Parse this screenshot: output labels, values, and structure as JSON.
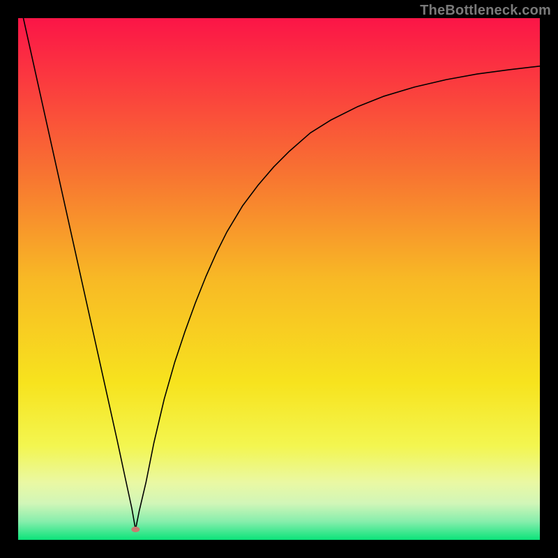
{
  "watermark": "TheBottleneck.com",
  "chart_data": {
    "type": "line",
    "title": "",
    "xlabel": "",
    "ylabel": "",
    "xlim": [
      0,
      100
    ],
    "ylim": [
      0,
      100
    ],
    "grid": false,
    "legend": false,
    "background_gradient": {
      "stops": [
        {
          "offset": 0.0,
          "color": "#fb1547"
        },
        {
          "offset": 0.12,
          "color": "#fb3a3f"
        },
        {
          "offset": 0.3,
          "color": "#f87431"
        },
        {
          "offset": 0.5,
          "color": "#f8b925"
        },
        {
          "offset": 0.7,
          "color": "#f7e31e"
        },
        {
          "offset": 0.82,
          "color": "#f3f650"
        },
        {
          "offset": 0.89,
          "color": "#eaf8a3"
        },
        {
          "offset": 0.93,
          "color": "#d1f6b8"
        },
        {
          "offset": 0.965,
          "color": "#86eeac"
        },
        {
          "offset": 1.0,
          "color": "#0be37a"
        }
      ]
    },
    "marker": {
      "x": 22.5,
      "y": 2.0,
      "color": "#c97b70",
      "rx": 6,
      "ry": 4
    },
    "series": [
      {
        "name": "curve",
        "stroke": "#000000",
        "stroke_width": 1.6,
        "x": [
          1.0,
          3.0,
          5.0,
          7.0,
          9.0,
          11.0,
          13.0,
          15.0,
          17.0,
          19.0,
          20.5,
          21.8,
          22.5,
          23.2,
          24.5,
          26.0,
          28.0,
          30.0,
          32.0,
          34.0,
          36.0,
          38.0,
          40.0,
          43.0,
          46.0,
          49.0,
          52.0,
          56.0,
          60.0,
          65.0,
          70.0,
          76.0,
          82.0,
          88.0,
          94.0,
          100.0
        ],
        "y": [
          100.0,
          91.0,
          82.0,
          73.0,
          64.0,
          55.0,
          46.0,
          37.0,
          28.0,
          19.0,
          12.0,
          6.0,
          2.0,
          5.5,
          11.0,
          18.5,
          27.0,
          34.0,
          40.0,
          45.5,
          50.5,
          55.0,
          59.0,
          64.0,
          68.0,
          71.5,
          74.5,
          78.0,
          80.5,
          83.0,
          85.0,
          86.8,
          88.2,
          89.3,
          90.1,
          90.8
        ]
      }
    ]
  }
}
